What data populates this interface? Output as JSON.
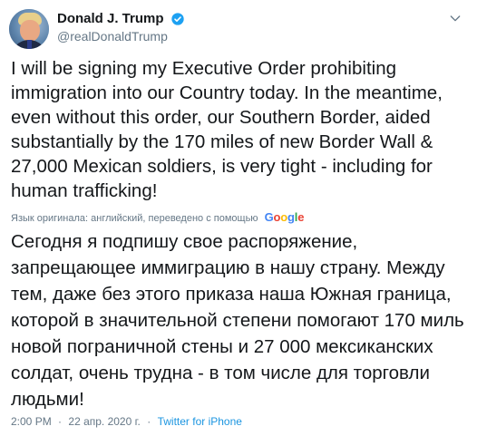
{
  "user": {
    "display_name": "Donald J. Trump",
    "handle": "@realDonaldTrump",
    "avatar_icon": "avatar-photo",
    "verified_icon": "verified-badge-icon"
  },
  "tweet": {
    "text": "I will be signing my Executive Order prohibiting immigration into our Country today. In the meantime, even without this order, our Southern Border, aided substantially by the 170 miles of new Border Wall & 27,000 Mexican soldiers, is very tight - including for human trafficking!",
    "translation_notice": "Язык оригинала: английский, переведено с помощью",
    "translation_provider": "Google",
    "translated_text": "Сегодня я подпишу свое распоряжение, запрещающее иммиграцию в нашу страну. Между тем, даже без этого приказа наша Южная граница, которой в значительной степени помогают 170 миль новой пограничной стены и 27 000 мексиканских солдат, очень трудна - в том числе для торговли людьми!"
  },
  "meta": {
    "time": "2:00 PM",
    "date": "22 апр. 2020 г.",
    "separator": "·",
    "source": "Twitter for iPhone"
  },
  "colors": {
    "text": "#14171a",
    "secondary": "#657786",
    "link": "#1b95e0",
    "verified": "#1da1f2"
  }
}
